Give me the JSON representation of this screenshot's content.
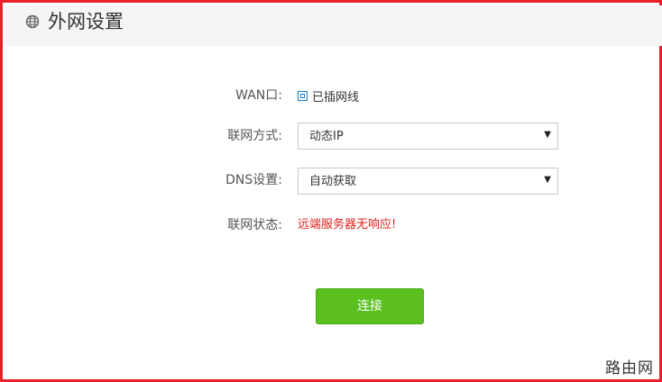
{
  "header": {
    "icon": "globe-icon",
    "title": "外网设置"
  },
  "form": {
    "wan_label": "WAN口:",
    "wan_checkbox_label": "已插网线",
    "wan_checkbox_checked": false,
    "connection_type_label": "联网方式:",
    "connection_type_value": "动态IP",
    "dns_label": "DNS设置:",
    "dns_value": "自动获取",
    "status_label": "联网状态:",
    "status_value": "远端服务器无响应!"
  },
  "actions": {
    "connect_label": "连接"
  },
  "watermark": "路由网",
  "colors": {
    "border": "#e8202a",
    "header_bg": "#f5f5f5",
    "button": "#5abf1f",
    "status_error": "#e0201c",
    "checkbox": "#1a7fc4"
  }
}
